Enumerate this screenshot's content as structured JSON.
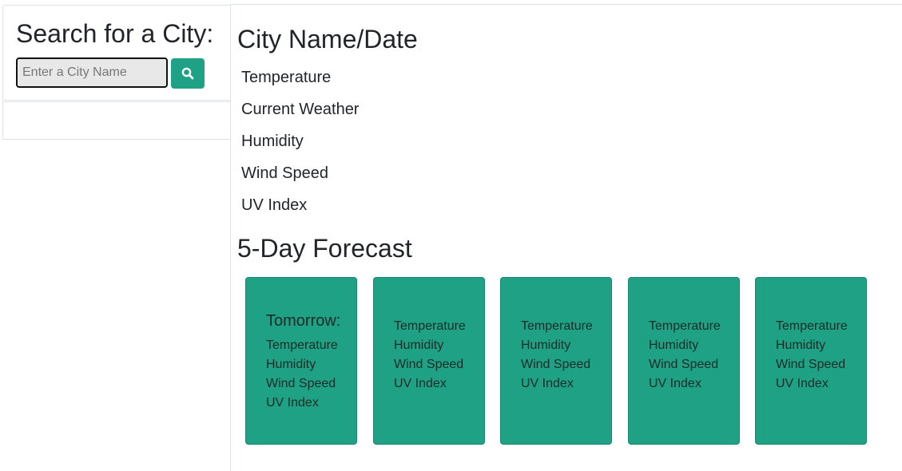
{
  "sidebar": {
    "title": "Search for a City:",
    "search_input": {
      "placeholder": "Enter a City Name",
      "value": ""
    },
    "search_button_icon": "search-icon"
  },
  "main": {
    "city_title": "City Name/Date",
    "stats": [
      "Temperature",
      "Current Weather",
      "Humidity",
      "Wind Speed",
      "UV Index"
    ],
    "forecast_title": "5-Day Forecast",
    "forecast": [
      {
        "title": "Tomorrow:",
        "lines": [
          "Temperature",
          "Humidity",
          "Wind Speed",
          "UV Index"
        ]
      },
      {
        "title": "",
        "lines": [
          "Temperature",
          "Humidity",
          "Wind Speed",
          "UV Index"
        ]
      },
      {
        "title": "",
        "lines": [
          "Temperature",
          "Humidity",
          "Wind Speed",
          "UV Index"
        ]
      },
      {
        "title": "",
        "lines": [
          "Temperature",
          "Humidity",
          "Wind Speed",
          "UV Index"
        ]
      },
      {
        "title": "",
        "lines": [
          "Temperature",
          "Humidity",
          "Wind Speed",
          "UV Index"
        ]
      }
    ]
  },
  "colors": {
    "accent": "#1fa185",
    "card_text": "#1b2b27",
    "border": "#dee2e6"
  }
}
